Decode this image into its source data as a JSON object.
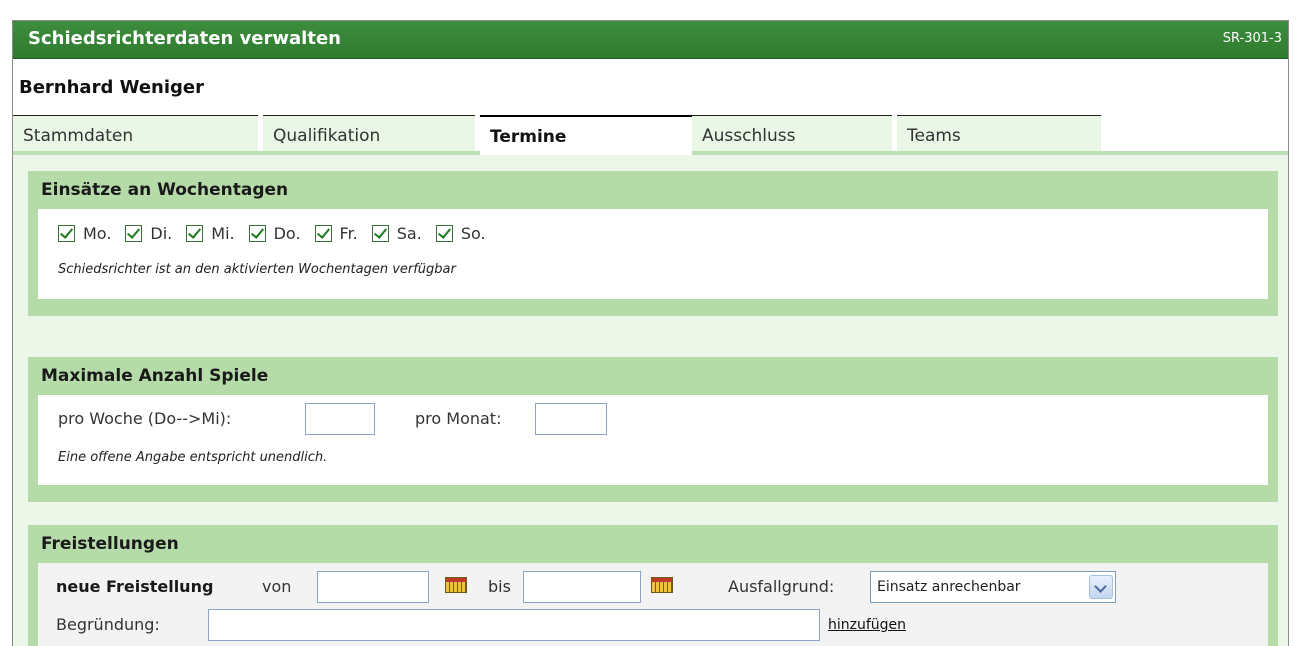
{
  "window": {
    "title": "Schiedsrichterdaten verwalten",
    "code": "SR-301-3"
  },
  "person": {
    "name": "Bernhard Weniger"
  },
  "tabs": [
    {
      "label": "Stammdaten",
      "active": false
    },
    {
      "label": "Qualifikation",
      "active": false
    },
    {
      "label": "Termine",
      "active": true
    },
    {
      "label": "Ausschluss",
      "active": false
    },
    {
      "label": "Teams",
      "active": false
    }
  ],
  "weekdays": {
    "title": "Einsätze an Wochentagen",
    "days": [
      {
        "label": "Mo.",
        "checked": true
      },
      {
        "label": "Di.",
        "checked": true
      },
      {
        "label": "Mi.",
        "checked": true
      },
      {
        "label": "Do.",
        "checked": true
      },
      {
        "label": "Fr.",
        "checked": true
      },
      {
        "label": "Sa.",
        "checked": true
      },
      {
        "label": "So.",
        "checked": true
      }
    ],
    "note": "Schiedsrichter ist an den aktivierten Wochentagen verfügbar"
  },
  "max_games": {
    "title": "Maximale Anzahl Spiele",
    "per_week_label": "pro Woche (Do-->Mi):",
    "per_week_value": "",
    "per_month_label": "pro Monat:",
    "per_month_value": "",
    "note": "Eine offene Angabe entspricht unendlich."
  },
  "exemptions": {
    "title": "Freistellungen",
    "new_label": "neue Freistellung",
    "from_label": "von",
    "from_value": "",
    "to_label": "bis",
    "to_value": "",
    "reason_type_label": "Ausfallgrund:",
    "reason_type_value": "Einsatz anrechenbar",
    "justification_label": "Begründung:",
    "justification_value": "",
    "add_link": "hinzufügen"
  },
  "icons": {
    "calendar": "calendar-icon",
    "checkbox": "checkbox-checked-icon",
    "dropdown": "chevron-down-icon"
  },
  "colors": {
    "title_bar": "#2f7a2f",
    "section_header": "#b5dca8",
    "content_background": "#edf7e9",
    "tab_background": "#eaf6e6"
  }
}
